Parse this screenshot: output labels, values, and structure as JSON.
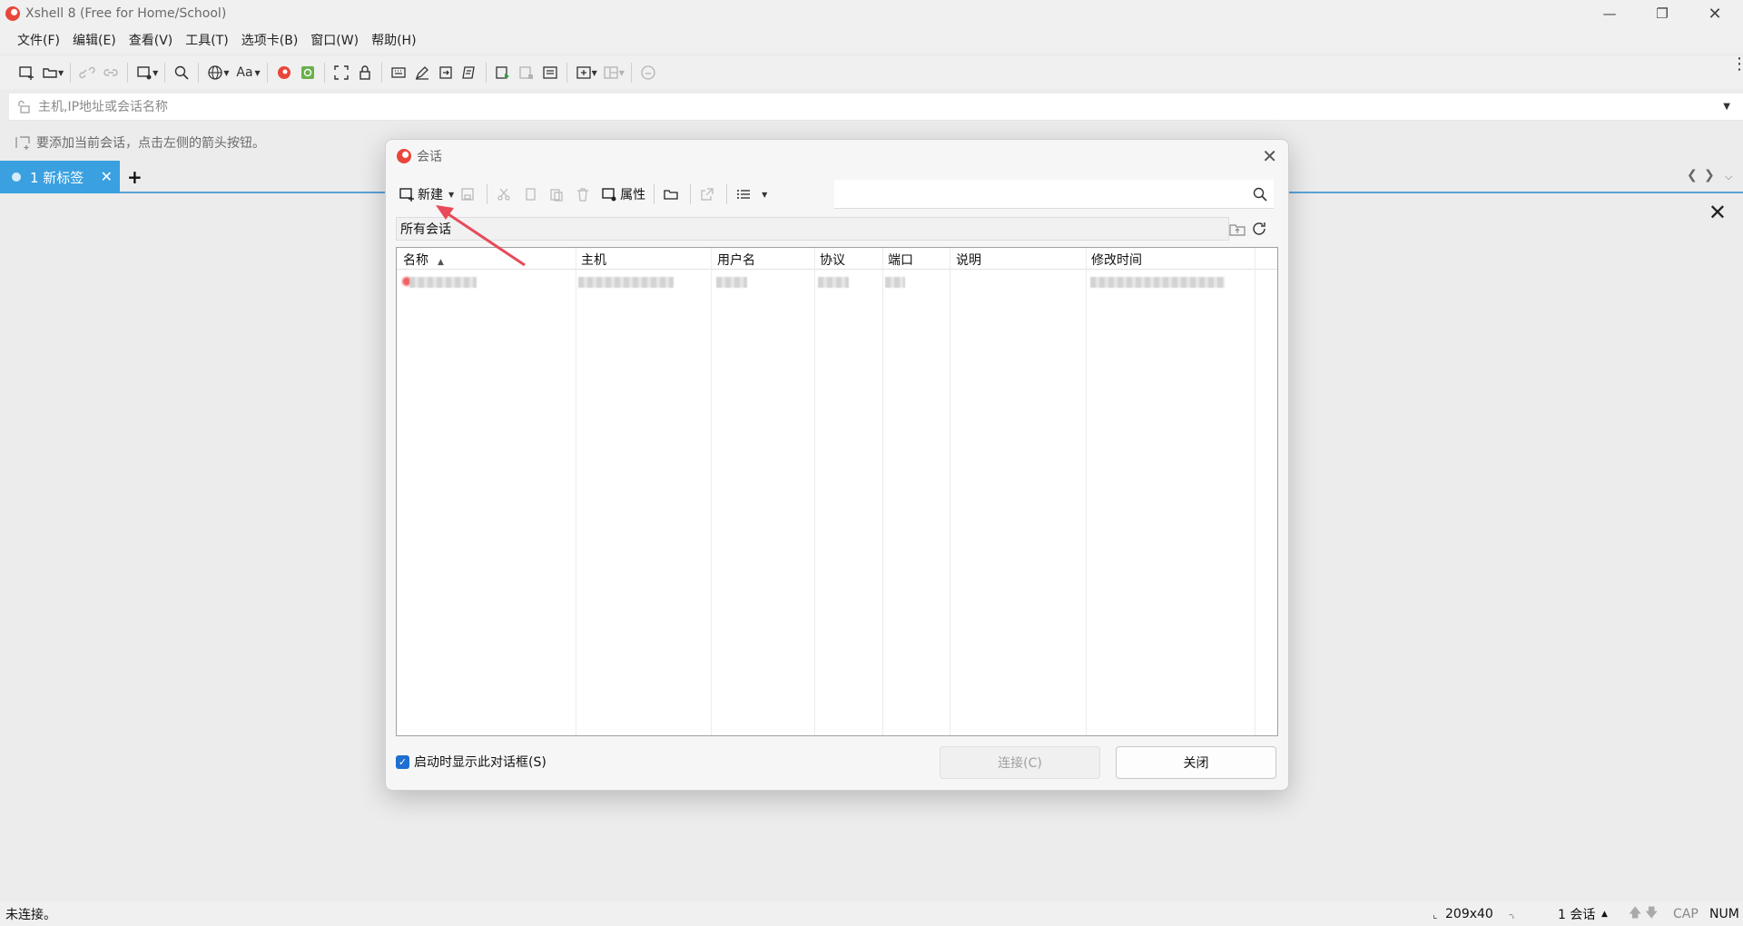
{
  "window": {
    "title": "Xshell 8 (Free for Home/School)"
  },
  "menu": [
    "文件(F)",
    "编辑(E)",
    "查看(V)",
    "工具(T)",
    "选项卡(B)",
    "窗口(W)",
    "帮助(H)"
  ],
  "address_bar": {
    "placeholder": "主机,IP地址或会话名称"
  },
  "hint": {
    "text": "要添加当前会话，点击左侧的箭头按钮。"
  },
  "tabs": [
    {
      "label": "1 新标签",
      "active": true
    }
  ],
  "dialog": {
    "title": "会话",
    "toolbar": {
      "new_label": "新建",
      "properties_label": "属性"
    },
    "search_placeholder": "",
    "path": "所有会话",
    "columns": [
      "名称",
      "主机",
      "用户名",
      "协议",
      "端口",
      "说明",
      "修改时间"
    ],
    "sort_column": "名称",
    "rows_note": "1 row, contents pixelated/blurred",
    "checkbox": {
      "label": "启动时显示此对话框(S)",
      "checked": true
    },
    "buttons": {
      "connect": "连接(C)",
      "close": "关闭"
    }
  },
  "status": {
    "connection": "未连接。",
    "size": "209x40",
    "sessions": "1 会话",
    "cap": "CAP",
    "num": "NUM"
  },
  "colors": {
    "tab_active": "#3aa0e0",
    "accent_line": "#5aa3d8",
    "brand": "#e8463a",
    "annotation_arrow": "#e84a5a"
  }
}
